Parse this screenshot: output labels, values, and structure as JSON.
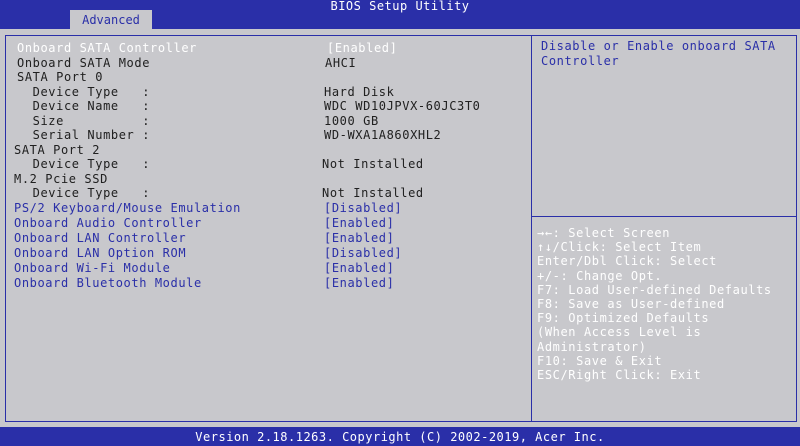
{
  "header": {
    "title": "BIOS Setup Utility",
    "tab": "Advanced"
  },
  "settings": [
    {
      "label": "Onboard SATA Controller",
      "value": "[Enabled]"
    },
    {
      "label": "Onboard SATA Mode",
      "value": "AHCI"
    },
    {
      "label": "SATA Port 0",
      "value": ""
    },
    {
      "label": "  Device Type   :",
      "value": "Hard Disk"
    },
    {
      "label": "  Device Name   :",
      "value": "WDC WD10JPVX-60JC3T0"
    },
    {
      "label": "  Size          :",
      "value": "1000 GB"
    },
    {
      "label": "  Serial Number :",
      "value": "WD-WXA1A860XHL2"
    },
    {
      "label": "SATA Port 2",
      "value": ""
    },
    {
      "label": "  Device Type   :",
      "value": "Not Installed"
    },
    {
      "label": "M.2 Pcie SSD",
      "value": ""
    },
    {
      "label": "  Device Type   :",
      "value": "Not Installed"
    },
    {
      "label": "PS/2 Keyboard/Mouse Emulation",
      "value": "[Disabled]"
    },
    {
      "label": "Onboard Audio Controller",
      "value": "[Enabled]"
    },
    {
      "label": "Onboard LAN Controller",
      "value": "[Enabled]"
    },
    {
      "label": "Onboard LAN Option ROM",
      "value": "[Disabled]"
    },
    {
      "label": "Onboard Wi-Fi Module",
      "value": "[Enabled]"
    },
    {
      "label": "Onboard Bluetooth Module",
      "value": "[Enabled]"
    }
  ],
  "help": {
    "text": "Disable or Enable onboard SATA Controller"
  },
  "keys": [
    "→←: Select Screen",
    "↑↓/Click: Select Item",
    "Enter/Dbl Click: Select",
    "+/-: Change Opt.",
    "F7: Load User-defined Defaults",
    "F8: Save as User-defined",
    "F9: Optimized Defaults",
    "(When Access Level is",
    "Administrator)",
    "F10: Save & Exit",
    "ESC/Right Click: Exit"
  ],
  "footer": {
    "text": "Version 2.18.1263. Copyright (C) 2002-2019, Acer Inc."
  },
  "colors": {
    "accent": "#2a2fa8",
    "background": "#c8c8cc",
    "highlight": "#ffffff"
  }
}
